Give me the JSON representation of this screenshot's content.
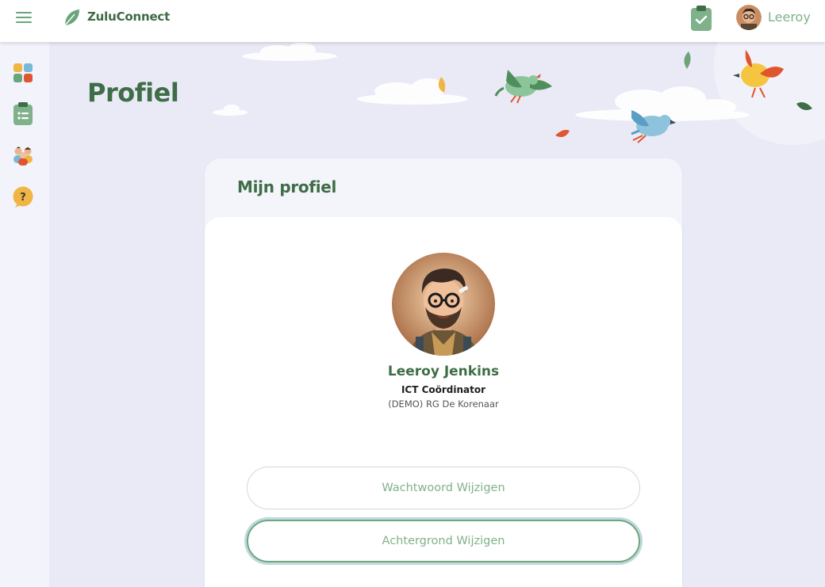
{
  "app": {
    "brand": "ZuluConnect",
    "user_name": "Leeroy"
  },
  "page": {
    "title": "Profiel"
  },
  "profile_card": {
    "heading": "Mijn profiel",
    "name": "Leeroy Jenkins",
    "role": "ICT Coördinator",
    "organization": "(DEMO) RG De Korenaar",
    "buttons": {
      "change_password": "Wachtwoord Wijzigen",
      "change_background": "Achtergrond Wijzigen"
    }
  },
  "sidebar": {
    "items": [
      {
        "icon": "dashboard-tiles-icon"
      },
      {
        "icon": "clipboard-list-icon"
      },
      {
        "icon": "people-icon"
      },
      {
        "icon": "help-bubble-icon"
      }
    ]
  },
  "colors": {
    "accent_green": "#3e6d47",
    "light_green": "#7fb28a",
    "background": "#e9eaf6"
  }
}
